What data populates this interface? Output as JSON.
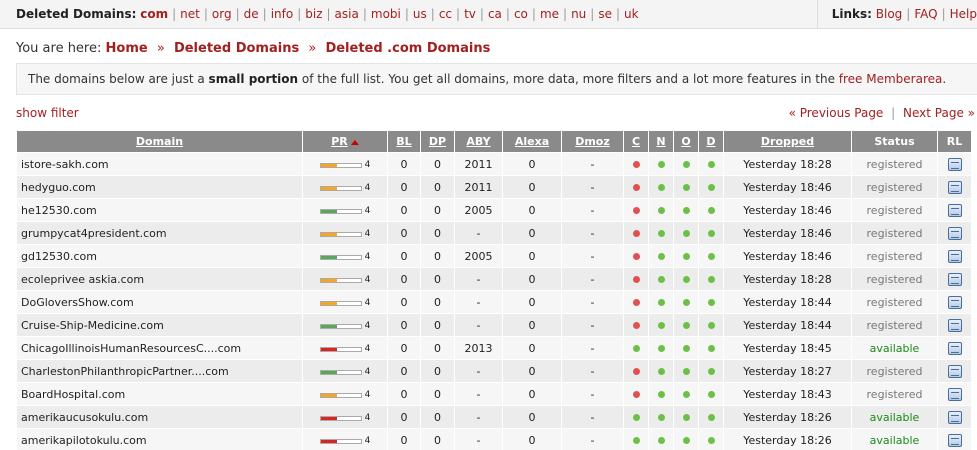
{
  "topbar": {
    "title": "Deleted Domains:",
    "tlds": [
      "com",
      "net",
      "org",
      "de",
      "info",
      "biz",
      "asia",
      "mobi",
      "us",
      "cc",
      "tv",
      "ca",
      "co",
      "me",
      "nu",
      "se",
      "uk"
    ],
    "active_tld": "com",
    "links_label": "Links:",
    "links": [
      "Blog",
      "FAQ",
      "Help"
    ]
  },
  "breadcrumb": {
    "prefix": "You are here:",
    "items": [
      "Home",
      "Deleted Domains",
      "Deleted .com Domains"
    ],
    "separator": "»"
  },
  "notice": {
    "text1": "The domains below are just a ",
    "bold": "small portion",
    "text2": " of the full list. You get all domains, more data, more filters and a lot more features in the ",
    "link": "free Memberarea",
    "text3": "."
  },
  "filter": {
    "show_filter": "show filter",
    "prev": "« Previous Page",
    "divider": "|",
    "next": "Next Page »"
  },
  "colors": {
    "green_dot": "#6cc04a",
    "red_dot": "#e05252",
    "bar_orange": "#f5a623",
    "bar_green": "#5aa75a",
    "bar_red": "#dd2222",
    "header_bg": "#8a8a8a"
  },
  "table": {
    "headers": [
      "Domain",
      "PR",
      "BL",
      "DP",
      "ABY",
      "Alexa",
      "Dmoz",
      "C",
      "N",
      "O",
      "D",
      "Dropped",
      "Status",
      "RL"
    ],
    "rows": [
      {
        "domain": "istore-sakh.com",
        "pr": 4,
        "bar_color": "orange",
        "bar_fill": 0.4,
        "bl": "0",
        "dp": "0",
        "aby": "2011",
        "alexa": "0",
        "dmoz": "-",
        "c": "red",
        "n": "green",
        "o": "green",
        "d": "green",
        "dropped": "Yesterday 18:28",
        "status": "registered"
      },
      {
        "domain": "hedyguo.com",
        "pr": 4,
        "bar_color": "orange",
        "bar_fill": 0.4,
        "bl": "0",
        "dp": "0",
        "aby": "2011",
        "alexa": "0",
        "dmoz": "-",
        "c": "red",
        "n": "green",
        "o": "green",
        "d": "green",
        "dropped": "Yesterday 18:46",
        "status": "registered"
      },
      {
        "domain": "he12530.com",
        "pr": 4,
        "bar_color": "green",
        "bar_fill": 0.4,
        "bl": "0",
        "dp": "0",
        "aby": "2005",
        "alexa": "0",
        "dmoz": "-",
        "c": "red",
        "n": "green",
        "o": "green",
        "d": "green",
        "dropped": "Yesterday 18:46",
        "status": "registered"
      },
      {
        "domain": "grumpycat4president.com",
        "pr": 4,
        "bar_color": "orange",
        "bar_fill": 0.4,
        "bl": "0",
        "dp": "0",
        "aby": "-",
        "alexa": "0",
        "dmoz": "-",
        "c": "red",
        "n": "green",
        "o": "green",
        "d": "green",
        "dropped": "Yesterday 18:46",
        "status": "registered"
      },
      {
        "domain": "gd12530.com",
        "pr": 4,
        "bar_color": "green",
        "bar_fill": 0.4,
        "bl": "0",
        "dp": "0",
        "aby": "2005",
        "alexa": "0",
        "dmoz": "-",
        "c": "red",
        "n": "green",
        "o": "green",
        "d": "green",
        "dropped": "Yesterday 18:46",
        "status": "registered"
      },
      {
        "domain": "ecoleprivee askia.com",
        "pr": 4,
        "bar_color": "orange",
        "bar_fill": 0.4,
        "bl": "0",
        "dp": "0",
        "aby": "-",
        "alexa": "0",
        "dmoz": "-",
        "c": "red",
        "n": "green",
        "o": "green",
        "d": "green",
        "dropped": "Yesterday 18:28",
        "status": "registered"
      },
      {
        "domain": "DoGloversShow.com",
        "pr": 4,
        "bar_color": "orange",
        "bar_fill": 0.4,
        "bl": "0",
        "dp": "0",
        "aby": "-",
        "alexa": "0",
        "dmoz": "-",
        "c": "red",
        "n": "green",
        "o": "green",
        "d": "green",
        "dropped": "Yesterday 18:44",
        "status": "registered"
      },
      {
        "domain": "Cruise-Ship-Medicine.com",
        "pr": 4,
        "bar_color": "green",
        "bar_fill": 0.4,
        "bl": "0",
        "dp": "0",
        "aby": "-",
        "alexa": "0",
        "dmoz": "-",
        "c": "red",
        "n": "green",
        "o": "green",
        "d": "green",
        "dropped": "Yesterday 18:44",
        "status": "registered"
      },
      {
        "domain": "ChicagoIllinoisHumanResourcesC....com",
        "pr": 4,
        "bar_color": "red",
        "bar_fill": 0.4,
        "bl": "0",
        "dp": "0",
        "aby": "2013",
        "alexa": "0",
        "dmoz": "-",
        "c": "green",
        "n": "green",
        "o": "green",
        "d": "green",
        "dropped": "Yesterday 18:45",
        "status": "available"
      },
      {
        "domain": "CharlestonPhilanthropicPartner....com",
        "pr": 4,
        "bar_color": "green",
        "bar_fill": 0.4,
        "bl": "0",
        "dp": "0",
        "aby": "-",
        "alexa": "0",
        "dmoz": "-",
        "c": "red",
        "n": "green",
        "o": "green",
        "d": "green",
        "dropped": "Yesterday 18:27",
        "status": "registered"
      },
      {
        "domain": "BoardHospital.com",
        "pr": 4,
        "bar_color": "orange",
        "bar_fill": 0.4,
        "bl": "0",
        "dp": "0",
        "aby": "-",
        "alexa": "0",
        "dmoz": "-",
        "c": "red",
        "n": "green",
        "o": "green",
        "d": "green",
        "dropped": "Yesterday 18:43",
        "status": "registered"
      },
      {
        "domain": "amerikaucusokulu.com",
        "pr": 4,
        "bar_color": "red",
        "bar_fill": 0.4,
        "bl": "0",
        "dp": "0",
        "aby": "-",
        "alexa": "0",
        "dmoz": "-",
        "c": "green",
        "n": "green",
        "o": "green",
        "d": "green",
        "dropped": "Yesterday 18:26",
        "status": "available"
      },
      {
        "domain": "amerikapilotokulu.com",
        "pr": 4,
        "bar_color": "red",
        "bar_fill": 0.4,
        "bl": "0",
        "dp": "0",
        "aby": "-",
        "alexa": "0",
        "dmoz": "-",
        "c": "green",
        "n": "green",
        "o": "green",
        "d": "green",
        "dropped": "Yesterday 18:26",
        "status": "available"
      }
    ]
  }
}
